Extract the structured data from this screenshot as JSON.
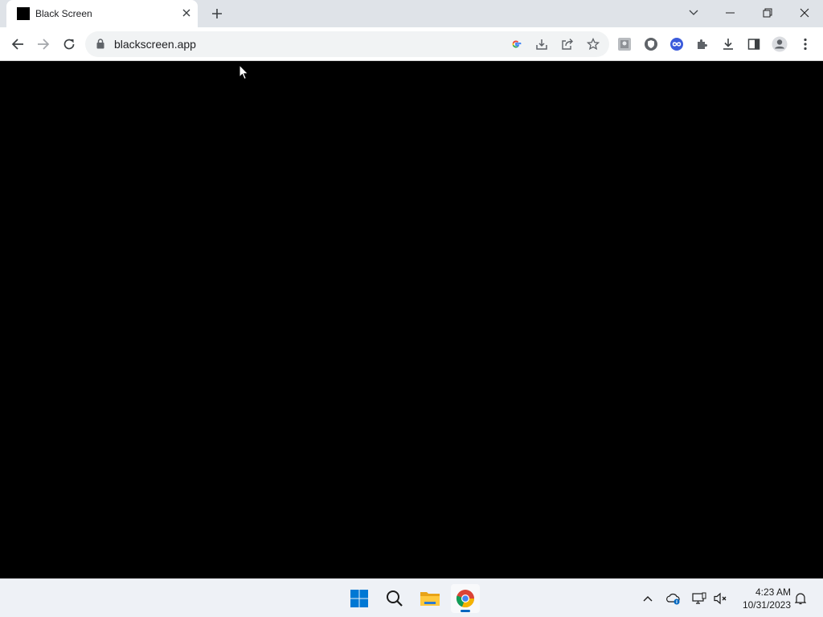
{
  "browser": {
    "tab": {
      "title": "Black Screen",
      "favicon": "black-square-icon"
    },
    "address_bar": {
      "url": "blackscreen.app"
    },
    "toolbar_icons": [
      "back-icon",
      "forward-icon",
      "reload-icon",
      "lock-icon",
      "google-lens-icon",
      "install-app-icon",
      "share-icon",
      "star-bookmark-icon",
      "extension-photo-icon",
      "extension-shield-icon",
      "extension-loop-icon",
      "extensions-puzzle-icon",
      "downloads-icon",
      "side-panel-icon",
      "profile-icon",
      "more-menu-icon"
    ],
    "window_controls": [
      "tab-search-icon",
      "minimize-icon",
      "restore-icon",
      "close-icon"
    ]
  },
  "page": {
    "background": "#000000"
  },
  "taskbar": {
    "apps": [
      "windows-start-icon",
      "search-icon",
      "file-explorer-icon",
      "chrome-icon"
    ],
    "active_app": "chrome-icon",
    "tray_icons": [
      "show-hidden-icons-icon",
      "onedrive-icon",
      "network-icon",
      "volume-muted-icon",
      "notifications-bell-icon"
    ],
    "time": "4:23 AM",
    "date": "10/31/2023"
  },
  "colors": {
    "accent": "#0067c0",
    "tabstrip": "#dfe3e8",
    "omnibox": "#f1f3f4"
  }
}
